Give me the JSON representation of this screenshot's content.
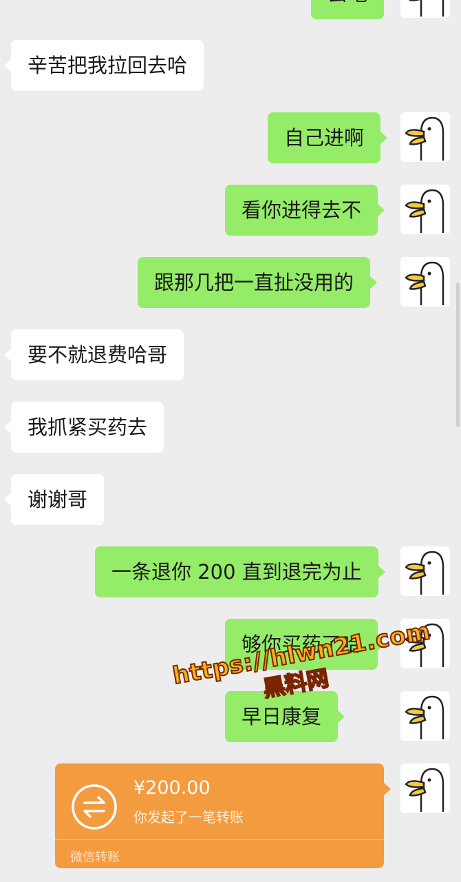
{
  "messages": {
    "m0": "去吧",
    "m1": "辛苦把我拉回去哈",
    "m2": "自己进啊",
    "m3": "看你进得去不",
    "m4": "跟那几把一直扯没用的",
    "m5": "要不就退费哈哥",
    "m6": "我抓紧买药去",
    "m7": "谢谢哥",
    "m8": "一条退你 200 直到退完为止",
    "m9": "够你买药了哈",
    "m10": "早日康复"
  },
  "transfer": {
    "amount": "¥200.00",
    "description": "你发起了一笔转账",
    "brand": "微信转账",
    "icon": "transfer-arrows-icon",
    "color": "#f39b3f"
  },
  "watermark": {
    "url": "https://hlwn21.com",
    "name": "黑料网"
  },
  "colors": {
    "background": "#ededed",
    "incoming_bubble": "#ffffff",
    "outgoing_bubble": "#95ec69"
  },
  "avatar": {
    "icon": "duck-avatar-icon"
  }
}
